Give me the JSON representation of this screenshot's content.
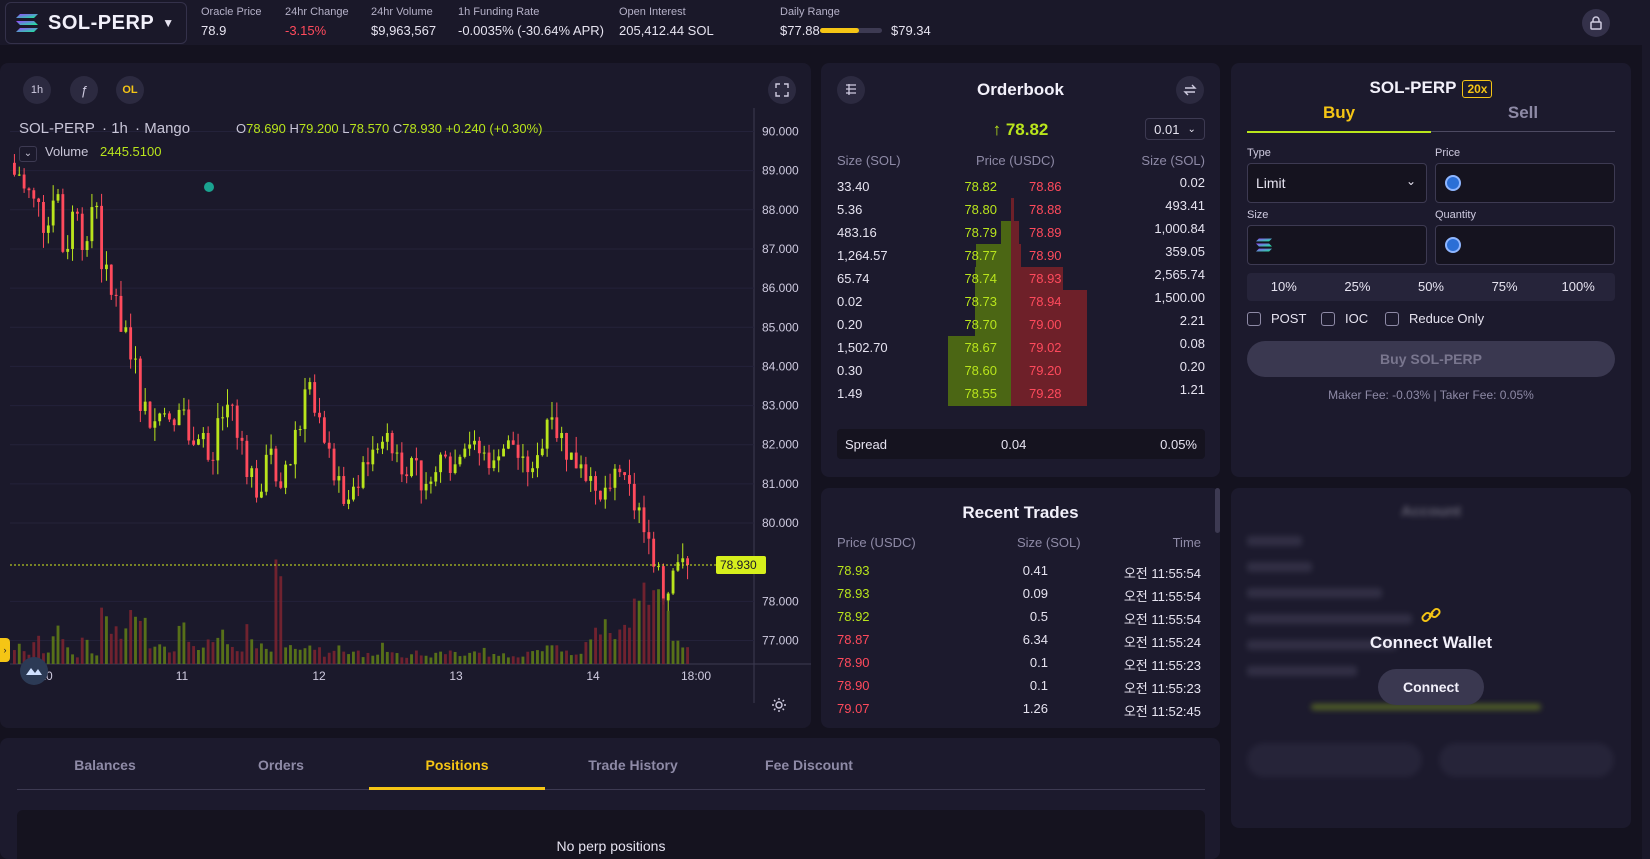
{
  "header": {
    "market": "SOL-PERP",
    "stats": [
      {
        "label": "Oracle Price",
        "value": "78.9"
      },
      {
        "label": "24hr Change",
        "value": "-3.15%"
      },
      {
        "label": "24hr Volume",
        "value": "$9,963,567"
      },
      {
        "label": "1h Funding Rate",
        "value": "-0.0035% (-30.64% APR)"
      },
      {
        "label": "Open Interest",
        "value": "205,412.44 SOL"
      }
    ],
    "daily_range": {
      "label": "Daily Range",
      "low": "$77.88",
      "high": "$79.34",
      "position": 0.63
    },
    "colors": {
      "accent": "#f5c515",
      "bid": "#b9e51c",
      "ask": "#ff4a5c"
    }
  },
  "chart": {
    "timeframe_buttons": [
      "1h",
      "ƒ",
      "OL"
    ],
    "legend": {
      "symbol": "SOL-PERP",
      "interval": "1h",
      "source": "Mango"
    },
    "ohlc": {
      "O": "78.690",
      "H": "79.200",
      "L": "78.570",
      "C": "78.930",
      "change": "+0.240 (+0.30%)"
    },
    "volume": {
      "label": "Volume",
      "value": "2445.5100"
    },
    "y_ticks": [
      "90.000",
      "89.000",
      "88.000",
      "87.000",
      "86.000",
      "85.000",
      "84.000",
      "83.000",
      "82.000",
      "81.000",
      "80.000",
      "78.000",
      "77.000"
    ],
    "current_price_label": "78.930",
    "x_ticks": [
      "10",
      "11",
      "12",
      "13",
      "14",
      "18:00"
    ]
  },
  "chart_data": {
    "type": "candlestick",
    "ylim": [
      76.4,
      90.6
    ],
    "x_ticks": [
      "10",
      "11",
      "12",
      "13",
      "14",
      "18:00"
    ],
    "close_path": [
      88.9,
      88.5,
      88.2,
      87.6,
      88.4,
      87.0,
      87.9,
      87.2,
      88.1,
      86.6,
      85.8,
      85.0,
      84.2,
      83.1,
      82.6,
      82.8,
      82.5,
      82.9,
      82.0,
      82.3,
      81.6,
      82.7,
      83.0,
      82.1,
      81.4,
      80.8,
      81.9,
      80.9,
      81.5,
      82.4,
      83.6,
      82.7,
      81.9,
      81.2,
      80.6,
      80.9,
      81.5,
      81.9,
      82.3,
      81.8,
      81.2,
      81.6,
      81.0,
      81.3,
      81.7,
      81.5,
      81.9,
      82.1,
      81.8,
      81.6,
      81.9,
      82.0,
      81.7,
      81.4,
      81.9,
      82.7,
      82.3,
      81.8,
      81.5,
      81.2,
      80.6,
      80.9,
      81.3,
      81.0,
      80.4,
      79.6,
      78.9,
      78.2,
      79.0,
      78.93
    ],
    "volume_profile": [
      0.15,
      0.1,
      0.2,
      0.12,
      0.3,
      0.18,
      0.08,
      0.22,
      0.1,
      0.4,
      0.3,
      0.25,
      0.5,
      0.35,
      0.2,
      0.18,
      0.15,
      0.3,
      0.22,
      0.12,
      0.18,
      0.25,
      0.15,
      0.1,
      0.28,
      0.2,
      0.12,
      1.0,
      0.15,
      0.18,
      0.2,
      0.12,
      0.08,
      0.15,
      0.1,
      0.12,
      0.08,
      0.1,
      0.15,
      0.12,
      0.08,
      0.1,
      0.06,
      0.08,
      0.1,
      0.12,
      0.08,
      0.1,
      0.12,
      0.08,
      0.1,
      0.06,
      0.08,
      0.1,
      0.12,
      0.2,
      0.15,
      0.1,
      0.12,
      0.2,
      0.3,
      0.35,
      0.25,
      0.4,
      0.5,
      0.7,
      0.85,
      0.6,
      0.2,
      0.15
    ]
  },
  "orderbook": {
    "title": "Orderbook",
    "mid_price": "↑ 78.82",
    "tick_size": "0.01",
    "headers": {
      "bid_size": "Size (SOL)",
      "price": "Price (USDC)",
      "ask_size": "Size (SOL)"
    },
    "rows": [
      {
        "bid_size": "33.40",
        "bid_price": "78.82",
        "ask_price": "78.86",
        "ask_size": "0.02",
        "bid_depth": 0.0,
        "ask_depth": 0.0
      },
      {
        "bid_size": "5.36",
        "bid_price": "78.80",
        "ask_price": "78.88",
        "ask_size": "493.41",
        "bid_depth": 0.0,
        "ask_depth": 0.03
      },
      {
        "bid_size": "483.16",
        "bid_price": "78.79",
        "ask_price": "78.89",
        "ask_size": "1,000.84",
        "bid_depth": 0.16,
        "ask_depth": 0.07
      },
      {
        "bid_size": "1,264.57",
        "bid_price": "78.77",
        "ask_price": "78.90",
        "ask_size": "359.05",
        "bid_depth": 0.55,
        "ask_depth": 0.09
      },
      {
        "bid_size": "65.74",
        "bid_price": "78.74",
        "ask_price": "78.93",
        "ask_size": "2,565.74",
        "bid_depth": 0.57,
        "ask_depth": 0.46
      },
      {
        "bid_size": "0.02",
        "bid_price": "78.73",
        "ask_price": "78.94",
        "ask_size": "1,500.00",
        "bid_depth": 0.57,
        "ask_depth": 0.68
      },
      {
        "bid_size": "0.20",
        "bid_price": "78.70",
        "ask_price": "79.00",
        "ask_size": "2.21",
        "bid_depth": 0.57,
        "ask_depth": 0.68
      },
      {
        "bid_size": "1,502.70",
        "bid_price": "78.67",
        "ask_price": "79.02",
        "ask_size": "0.08",
        "bid_depth": 1.0,
        "ask_depth": 0.68
      },
      {
        "bid_size": "0.30",
        "bid_price": "78.60",
        "ask_price": "79.20",
        "ask_size": "0.20",
        "bid_depth": 1.0,
        "ask_depth": 0.68
      },
      {
        "bid_size": "1.49",
        "bid_price": "78.55",
        "ask_price": "79.28",
        "ask_size": "1.21",
        "bid_depth": 1.0,
        "ask_depth": 0.68
      }
    ],
    "spread": {
      "label": "Spread",
      "value": "0.04",
      "percent": "0.05%"
    }
  },
  "recent_trades": {
    "title": "Recent Trades",
    "headers": {
      "price": "Price (USDC)",
      "size": "Size (SOL)",
      "time": "Time"
    },
    "rows": [
      {
        "price": "78.93",
        "size": "0.41",
        "time": "오전 11:55:54",
        "side": "buy"
      },
      {
        "price": "78.93",
        "size": "0.09",
        "time": "오전 11:55:54",
        "side": "buy"
      },
      {
        "price": "78.92",
        "size": "0.5",
        "time": "오전 11:55:54",
        "side": "buy"
      },
      {
        "price": "78.87",
        "size": "6.34",
        "time": "오전 11:55:24",
        "side": "sell"
      },
      {
        "price": "78.90",
        "size": "0.1",
        "time": "오전 11:55:23",
        "side": "sell"
      },
      {
        "price": "78.90",
        "size": "0.1",
        "time": "오전 11:55:23",
        "side": "sell"
      },
      {
        "price": "79.07",
        "size": "1.26",
        "time": "오전 11:52:45",
        "side": "sell"
      }
    ]
  },
  "order_form": {
    "title": "SOL-PERP",
    "leverage": "20x",
    "tabs": {
      "buy": "Buy",
      "sell": "Sell"
    },
    "type_label": "Type",
    "type_value": "Limit",
    "price_label": "Price",
    "size_label": "Size",
    "quantity_label": "Quantity",
    "percentages": [
      "10%",
      "25%",
      "50%",
      "75%",
      "100%"
    ],
    "checkboxes": {
      "post": "POST",
      "ioc": "IOC",
      "reduce_only": "Reduce Only"
    },
    "submit": "Buy SOL-PERP",
    "fees": "Maker Fee: -0.03% | Taker Fee: 0.05%"
  },
  "account": {
    "blurred_title": "Account",
    "connect_title": "Connect Wallet",
    "connect_button": "Connect"
  },
  "bottom_tabs": {
    "tabs": [
      "Balances",
      "Orders",
      "Positions",
      "Trade History",
      "Fee Discount"
    ],
    "active": "Positions",
    "empty_message": "No perp positions"
  }
}
